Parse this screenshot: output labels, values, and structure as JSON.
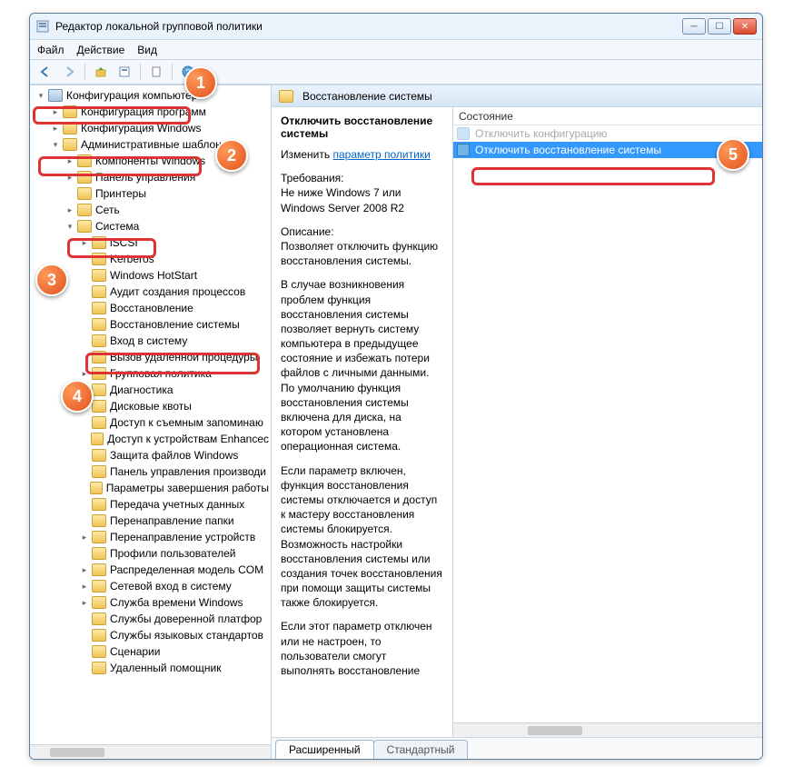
{
  "window": {
    "title": "Редактор локальной групповой политики"
  },
  "menu": {
    "file": "Файл",
    "action": "Действие",
    "view": "Вид"
  },
  "tree": {
    "root": "Конфигурация компьютера",
    "prog_cfg": "Конфигурация программ",
    "win_cfg": "Конфигурация Windows",
    "admin_templates": "Административные шаблоны",
    "win_components": "Компоненты Windows",
    "control_panel": "Панель управления",
    "printers": "Принтеры",
    "network": "Сеть",
    "system": "Система",
    "iscsi": "iSCSI",
    "kerberos": "Kerberos",
    "hotstart": "Windows HotStart",
    "audit": "Аудит создания процессов",
    "restore_dim": "Восстановление",
    "system_restore": "Восстановление системы",
    "logon": "Вход в систему",
    "rpc": "Вызов удаленной процедуры",
    "group_policy": "Групповая политика",
    "diag": "Диагностика",
    "disk_quotas": "Дисковые квоты",
    "removable": "Доступ к съемным запоминаю",
    "enhanced": "Доступ к устройствам Enhancec",
    "file_protect": "Защита файлов Windows",
    "perf_panel": "Панель управления производи",
    "shutdown": "Параметры завершения работы",
    "cred_transfer": "Передача учетных данных",
    "folder_redirect": "Перенаправление папки",
    "device_redirect": "Перенаправление устройств",
    "user_profiles": "Профили пользователей",
    "dcom": "Распределенная модель COM",
    "net_logon": "Сетевой вход в систему",
    "time_service": "Служба времени Windows",
    "trusted_plat": "Службы доверенной платфор",
    "lang_services": "Службы языковых стандартов",
    "scripts": "Сценарии",
    "remote_assist": "Удаленный помощник"
  },
  "pane": {
    "header": "Восстановление системы"
  },
  "description": {
    "policy_title": "Отключить восстановление системы",
    "change_prefix": "Изменить ",
    "change_link": "параметр политики",
    "req_label": "Требования:",
    "req_text": "Не ниже Windows 7 или Windows Server 2008 R2",
    "desc_label": "Описание:",
    "desc_p1": "Позволяет отключить функцию восстановления системы.",
    "desc_p2": "В случае возникновения проблем функция восстановления системы позволяет вернуть систему компьютера в предыдущее состояние и избежать потери файлов с личными данными. По умолчанию функция восстановления системы включена для диска, на котором установлена операционная система.",
    "desc_p3": "Если параметр включен, функция восстановления системы отключается и доступ к мастеру восстановления системы блокируется. Возможность настройки восстановления системы или создания точек восстановления при помощи защиты системы также блокируется.",
    "desc_p4": "Если этот параметр отключен или не настроен, то пользователи смогут выполнять восстановление"
  },
  "list": {
    "column": "Состояние",
    "row_hidden": "Отключить конфигурацию",
    "row_selected": "Отключить восстановление системы"
  },
  "tabs": {
    "extended": "Расширенный",
    "standard": "Стандартный"
  },
  "badges": {
    "b1": "1",
    "b2": "2",
    "b3": "3",
    "b4": "4",
    "b5": "5"
  }
}
